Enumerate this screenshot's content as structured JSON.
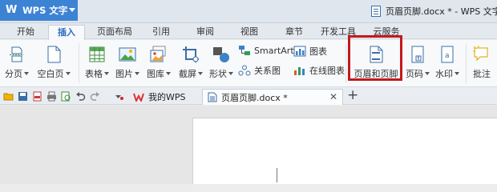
{
  "app": {
    "logo_text": "W",
    "name": "WPS 文字"
  },
  "window": {
    "title": "页眉页脚.docx * - WPS 文字"
  },
  "menu_tabs": [
    "开始",
    "插入",
    "页面布局",
    "引用",
    "审阅",
    "视图",
    "章节",
    "开发工具",
    "云服务"
  ],
  "ribbon": {
    "page_break": "分页",
    "blank_page": "空白页",
    "table": "表格",
    "picture": "图片",
    "gallery": "图库",
    "screenshot": "截屏",
    "shapes": "形状",
    "smartart": "SmartArt",
    "chart": "图表",
    "relation_diagram": "关系图",
    "online_chart": "在线图表",
    "header_footer": "页眉和页脚",
    "page_number": "页码",
    "watermark": "水印",
    "comment": "批注"
  },
  "doc_tabs": [
    {
      "label": "我的WPS"
    },
    {
      "label": "页眉页脚.docx *"
    }
  ],
  "colors": {
    "accent": "#3d83d4",
    "highlight": "#c4191c"
  }
}
